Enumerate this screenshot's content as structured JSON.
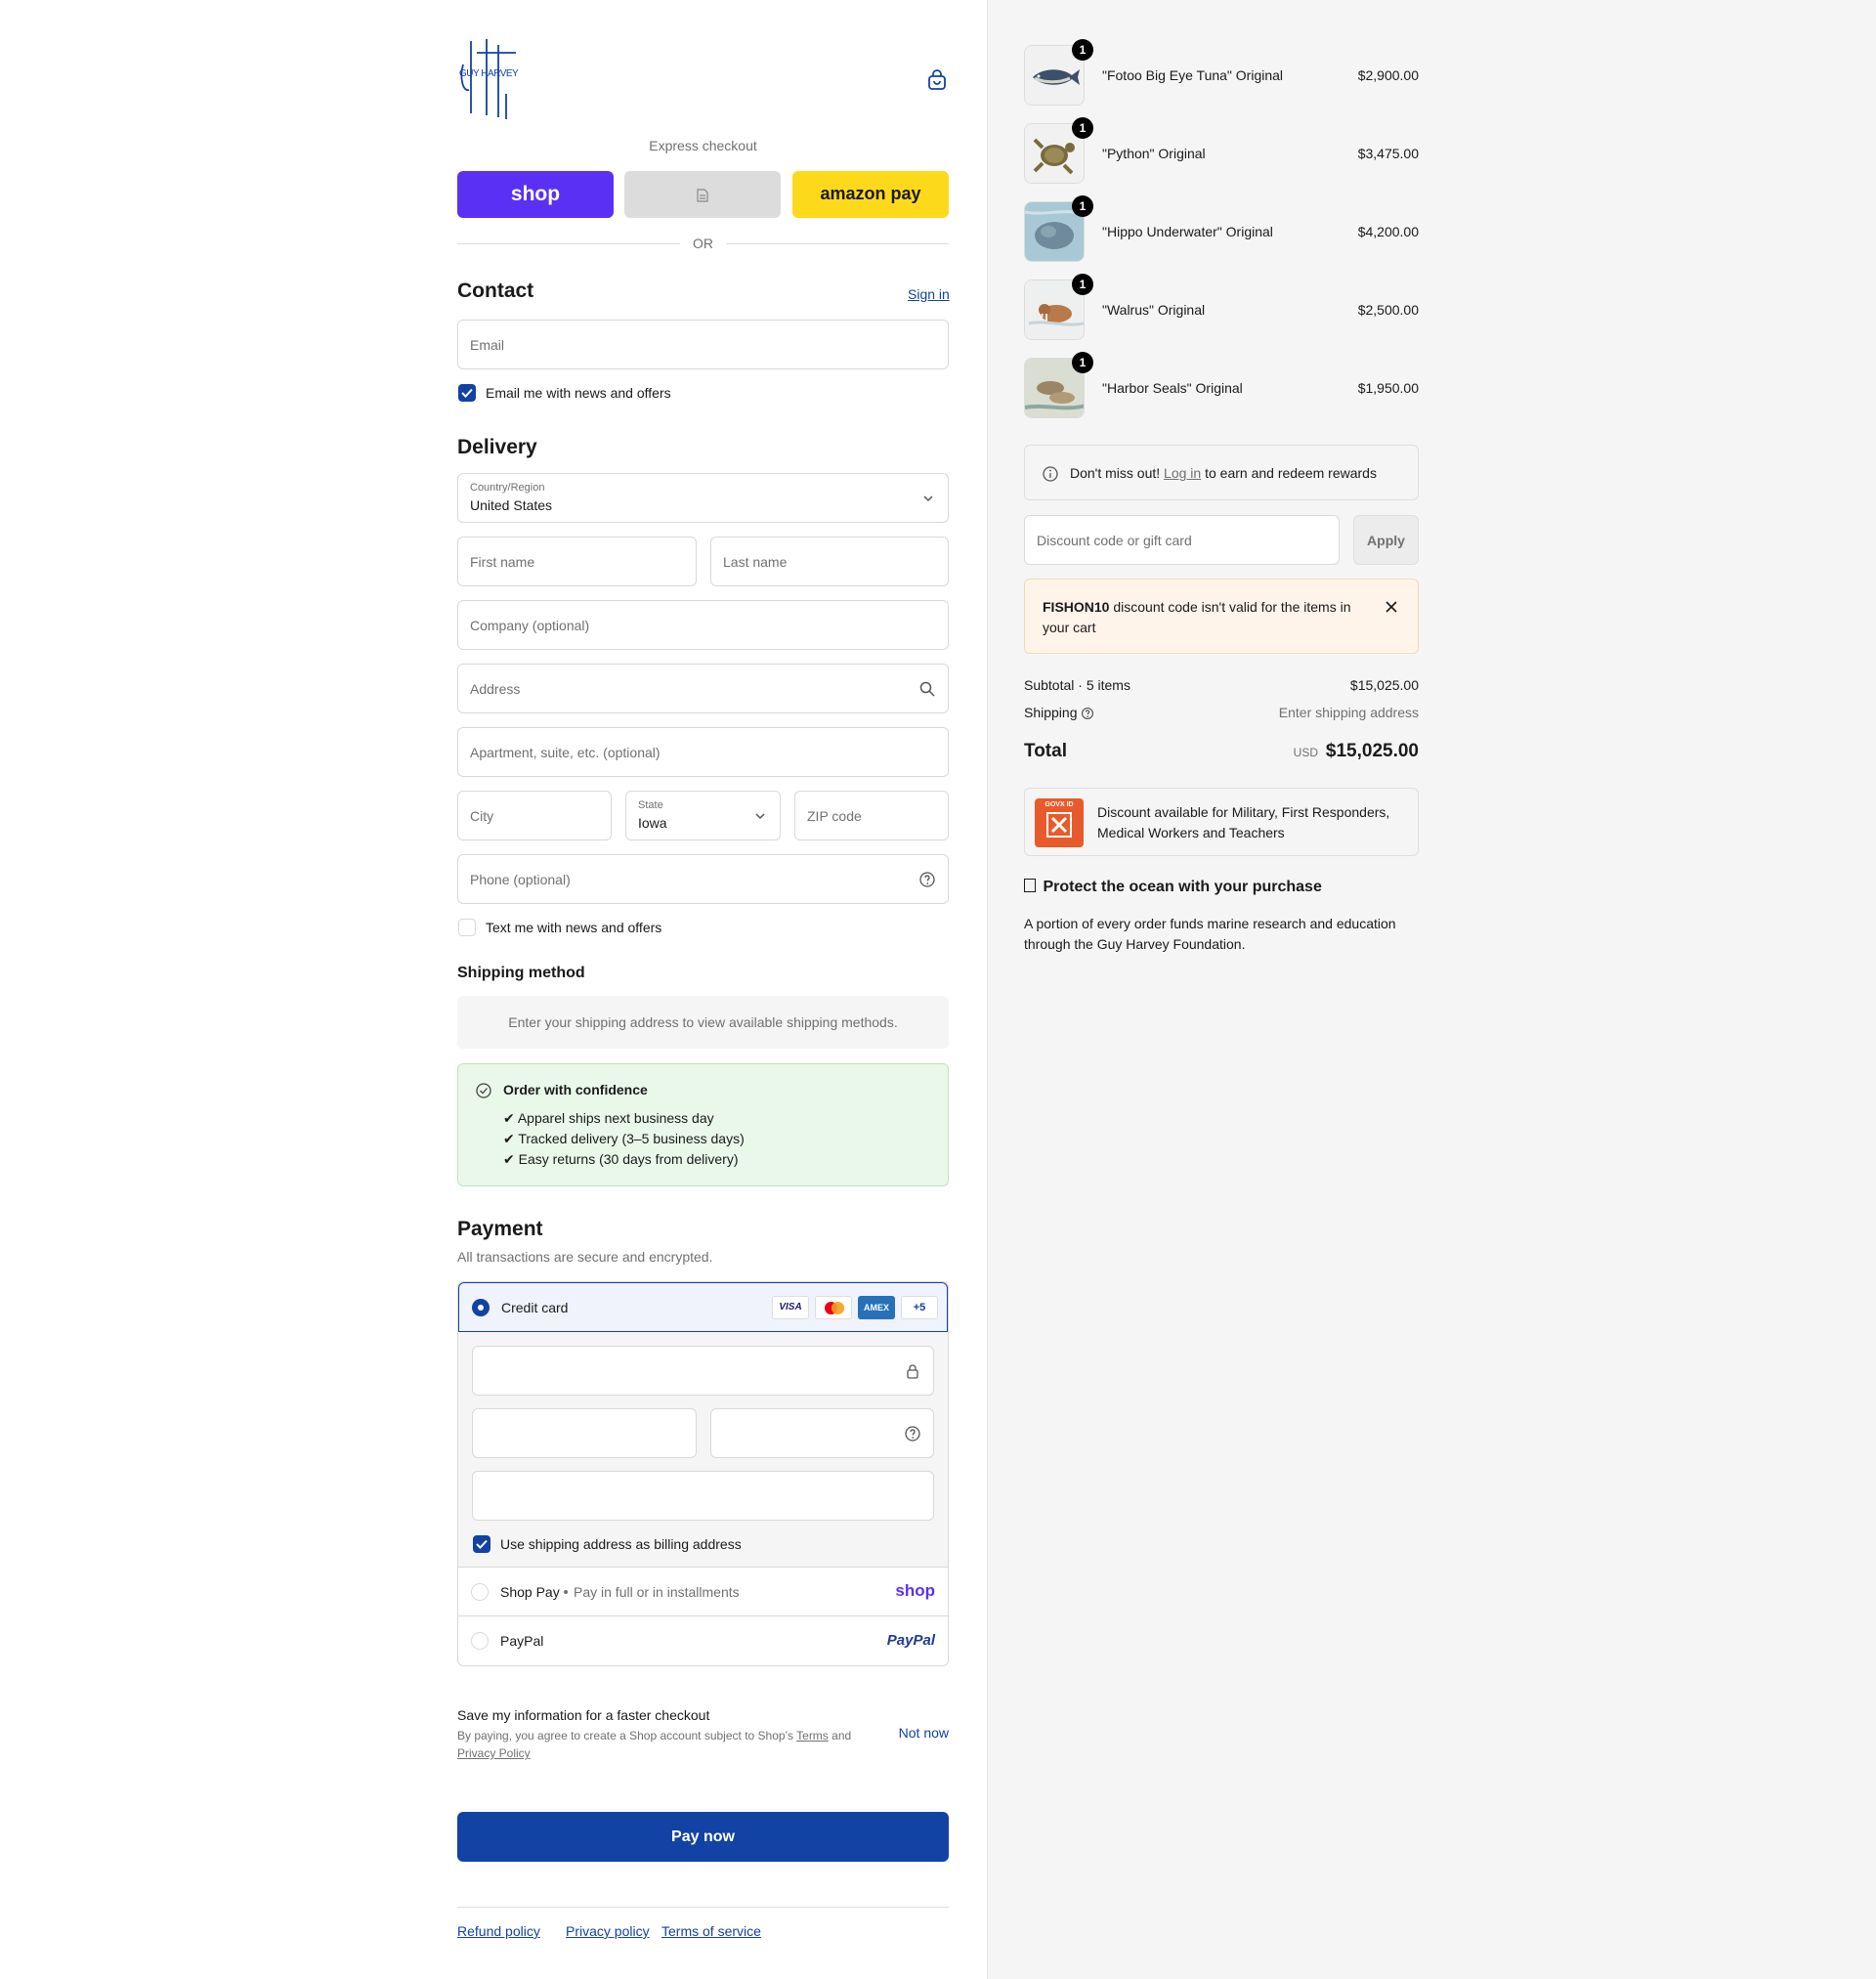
{
  "brand": {
    "logo_text": "GUY HARVEY"
  },
  "express": {
    "label": "Express checkout",
    "shop_label": "shop",
    "amazon_label": "amazon pay",
    "or_label": "OR"
  },
  "contact": {
    "title": "Contact",
    "sign_in": "Sign in",
    "email_placeholder": "Email",
    "news_label": "Email me with news and offers"
  },
  "delivery": {
    "title": "Delivery",
    "country_label": "Country/Region",
    "country_value": "United States",
    "first_name": "First name",
    "last_name": "Last name",
    "company": "Company (optional)",
    "address": "Address",
    "apartment": "Apartment, suite, etc. (optional)",
    "city": "City",
    "state_label": "State",
    "state_value": "Iowa",
    "zip": "ZIP code",
    "phone": "Phone (optional)",
    "text_me": "Text me with news and offers"
  },
  "shipping_method": {
    "title": "Shipping method",
    "message": "Enter your shipping address to view available shipping methods."
  },
  "confidence": {
    "title": "Order with confidence",
    "points": [
      "✔ Apparel ships next business day",
      "✔ Tracked delivery (3–5 business days)",
      "✔ Easy returns (30 days from delivery)"
    ]
  },
  "payment": {
    "title": "Payment",
    "subtitle": "All transactions are secure and encrypted.",
    "credit_card": "Credit card",
    "card_brands": [
      "VISA",
      "MC",
      "AMEX",
      "+5"
    ],
    "billing_same": "Use shipping address as billing address",
    "shop_pay": "Shop Pay",
    "shop_pay_note": "Pay in full or in installments",
    "shop_pay_logo": "shop",
    "paypal": "PayPal",
    "paypal_logo": "PayPal"
  },
  "save_info": {
    "title": "Save my information for a faster checkout",
    "legal_prefix": "By paying, you agree to create a Shop account subject to Shop’s",
    "terms": "Terms",
    "and": "and",
    "privacy": "Privacy Policy",
    "not_now": "Not now"
  },
  "pay_now": "Pay now",
  "footer": {
    "refund": "Refund policy",
    "privacy": "Privacy policy",
    "terms": "Terms of service"
  },
  "cart": {
    "items": [
      {
        "name": "\"Fotoo Big Eye Tuna\" Original",
        "price": "$2,900.00",
        "qty": "1"
      },
      {
        "name": "\"Python\" Original",
        "price": "$3,475.00",
        "qty": "1"
      },
      {
        "name": "\"Hippo Underwater\" Original",
        "price": "$4,200.00",
        "qty": "1"
      },
      {
        "name": "\"Walrus\" Original",
        "price": "$2,500.00",
        "qty": "1"
      },
      {
        "name": "\"Harbor Seals\" Original",
        "price": "$1,950.00",
        "qty": "1"
      }
    ],
    "rewards_prefix": "Don't miss out!",
    "rewards_link": "Log in",
    "rewards_suffix": "to earn and redeem rewards",
    "discount_placeholder": "Discount code or gift card",
    "apply": "Apply",
    "error_code": "FISHON10",
    "error_msg": "discount code isn't valid for the items in your cart",
    "subtotal_label": "Subtotal · 5 items",
    "subtotal_value": "$15,025.00",
    "shipping_label": "Shipping",
    "shipping_value": "Enter shipping address",
    "total_label": "Total",
    "currency": "USD",
    "total_value": "$15,025.00",
    "govx_text": "Discount available for Military, First Responders, Medical Workers and Teachers",
    "govx_logo": "GOVX ID",
    "ocean_title": "Protect the ocean with your purchase",
    "ocean_text": "A portion of every order funds marine research and education through the Guy Harvey Foundation."
  }
}
